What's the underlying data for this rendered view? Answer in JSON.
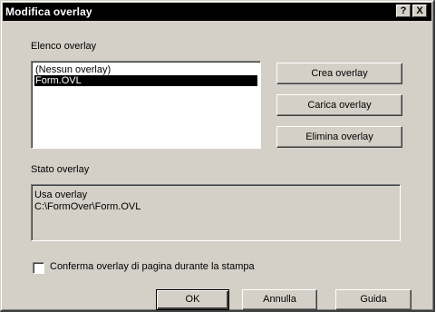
{
  "window": {
    "title": "Modifica overlay",
    "help_glyph": "?",
    "close_glyph": "X"
  },
  "overlay_list": {
    "label": "Elenco overlay",
    "items": [
      {
        "text": "(Nessun overlay)",
        "selected": false
      },
      {
        "text": "Form.OVL",
        "selected": true
      }
    ]
  },
  "actions": {
    "create": "Crea overlay",
    "load": "Carica overlay",
    "delete": "Elimina overlay"
  },
  "status": {
    "label": "Stato overlay",
    "lines": [
      "Usa overlay",
      "C:\\FormOver\\Form.OVL"
    ]
  },
  "confirm": {
    "label": "Conferma overlay di pagina durante la stampa",
    "checked": false
  },
  "footer": {
    "ok": "OK",
    "cancel": "Annulla",
    "help": "Guida"
  },
  "colors": {
    "face": "#d4d0c8",
    "titlebar": "#000000",
    "selection": "#000000"
  },
  "icons": {
    "help": "help-icon",
    "close": "close-icon"
  }
}
